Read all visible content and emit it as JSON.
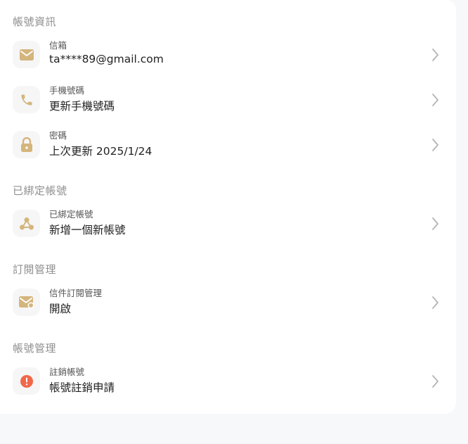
{
  "sections": [
    {
      "title": "帳號資訊",
      "items": [
        {
          "label": "信箱",
          "value": "ta****89@gmail.com",
          "icon": "mail-icon"
        },
        {
          "label": "手機號碼",
          "value": "更新手機號碼",
          "icon": "phone-icon"
        },
        {
          "label": "密碼",
          "value": "上次更新 2025/1/24",
          "icon": "lock-icon"
        }
      ]
    },
    {
      "title": "已綁定帳號",
      "items": [
        {
          "label": "已綁定帳號",
          "value": "新增一個新帳號",
          "icon": "share-icon"
        }
      ]
    },
    {
      "title": "訂閱管理",
      "items": [
        {
          "label": "信件訂閱管理",
          "value": "開啟",
          "icon": "mail-subscription-icon"
        }
      ]
    },
    {
      "title": "帳號管理",
      "items": [
        {
          "label": "註銷帳號",
          "value": "帳號註銷申請",
          "icon": "alert-icon"
        }
      ]
    }
  ],
  "colors": {
    "icon_gold": "#d4b57c",
    "alert_red": "#f2664a",
    "section_title": "#8f8f8f",
    "chevron": "#b5b5b5"
  }
}
